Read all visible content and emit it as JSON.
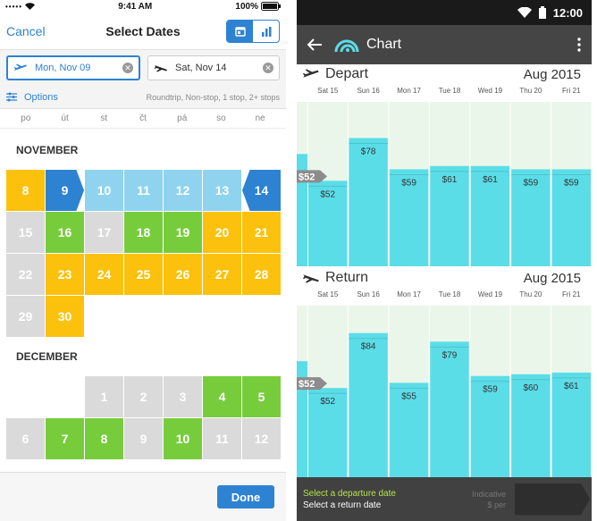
{
  "ios": {
    "status": {
      "time": "9:41 AM",
      "battery": "100%",
      "signal": "•••••"
    },
    "nav": {
      "cancel": "Cancel",
      "title": "Select Dates"
    },
    "depart_date": "Mon, Nov 09",
    "return_date": "Sat, Nov 14",
    "options_label": "Options",
    "options_summary": "Roundtrip, Non-stop, 1 stop, 2+ stops",
    "weekdays": [
      "po",
      "út",
      "st",
      "čt",
      "pá",
      "so",
      "ne"
    ],
    "november": {
      "label": "NOVEMBER",
      "rows": [
        [
          [
            "8",
            "y"
          ],
          [
            "9",
            "sel"
          ],
          [
            "10",
            "lb"
          ],
          [
            "11",
            "lb"
          ],
          [
            "12",
            "lb"
          ],
          [
            "13",
            "lb"
          ],
          [
            "14",
            "sel"
          ]
        ],
        [
          [
            "15",
            "gr"
          ],
          [
            "16",
            "g"
          ],
          [
            "17",
            "gr"
          ],
          [
            "18",
            "g"
          ],
          [
            "19",
            "g"
          ],
          [
            "20",
            "y"
          ],
          [
            "21",
            "y"
          ]
        ],
        [
          [
            "22",
            "gr"
          ],
          [
            "23",
            "y"
          ],
          [
            "24",
            "y"
          ],
          [
            "25",
            "y"
          ],
          [
            "26",
            "y"
          ],
          [
            "27",
            "y"
          ],
          [
            "28",
            "y"
          ]
        ],
        [
          [
            "29",
            "gr"
          ],
          [
            "30",
            "y"
          ],
          [
            "",
            "e"
          ],
          [
            "",
            "e"
          ],
          [
            "",
            "e"
          ],
          [
            "",
            "e"
          ],
          [
            "",
            "e"
          ]
        ]
      ]
    },
    "december": {
      "label": "DECEMBER",
      "rows": [
        [
          [
            "",
            "e"
          ],
          [
            "",
            "e"
          ],
          [
            "1",
            "gr"
          ],
          [
            "2",
            "gr"
          ],
          [
            "3",
            "gr"
          ],
          [
            "4",
            "g"
          ],
          [
            "5",
            "g"
          ]
        ],
        [
          [
            "6",
            "gr"
          ],
          [
            "7",
            "g"
          ],
          [
            "8",
            "g"
          ],
          [
            "9",
            "gr"
          ],
          [
            "10",
            "g"
          ],
          [
            "11",
            "gr"
          ],
          [
            "12",
            "gr"
          ]
        ]
      ]
    },
    "done": "Done",
    "colors": {
      "blue": "#2d82d2",
      "yellow": "#fbc10d",
      "green": "#77cc3c",
      "gray": "#dadada",
      "light_blue": "#8fd3ef"
    }
  },
  "android": {
    "status": {
      "time": "12:00"
    },
    "title": "Chart",
    "depart": {
      "label": "Depart",
      "month": "Aug 2015"
    },
    "return": {
      "label": "Return",
      "month": "Aug 2015"
    },
    "footer": {
      "line1": "Select a departure date",
      "line2": "Select a return date",
      "indicative": "Indicative",
      "per": "$ per"
    },
    "colors": {
      "bar": "#5bdde8",
      "bg": "#eaf6ea",
      "axis_label": "#555"
    }
  },
  "chart_data": [
    {
      "type": "bar",
      "title": "Depart",
      "categories": [
        "Sat 15",
        "Sun 16",
        "Mon 17",
        "Tue 18",
        "Wed 19",
        "Thu 20",
        "Fri 21"
      ],
      "values": [
        52,
        78,
        59,
        61,
        61,
        59,
        59
      ],
      "labels": [
        "$52",
        "$78",
        "$59",
        "$61",
        "$61",
        "$59",
        "$59"
      ],
      "reference": "$52"
    },
    {
      "type": "bar",
      "title": "Return",
      "categories": [
        "Sat 15",
        "Sun 16",
        "Mon 17",
        "Tue 18",
        "Wed 19",
        "Thu 20",
        "Fri 21"
      ],
      "values": [
        52,
        84,
        55,
        79,
        59,
        60,
        61
      ],
      "labels": [
        "$52",
        "$84",
        "$55",
        "$79",
        "$59",
        "$60",
        "$61"
      ],
      "reference": "$52"
    }
  ]
}
